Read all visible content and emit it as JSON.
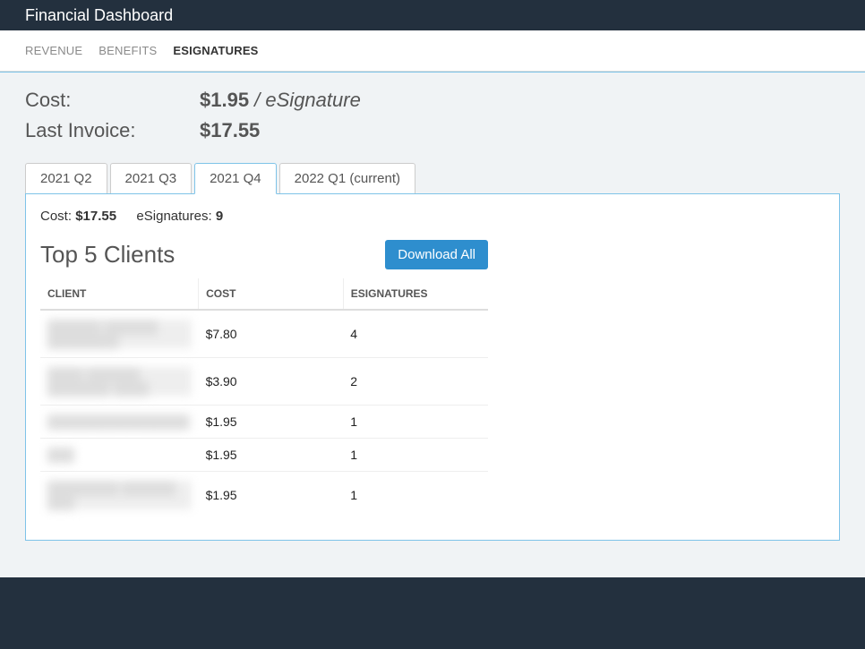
{
  "header": {
    "title": "Financial Dashboard"
  },
  "nav": {
    "items": [
      {
        "label": "Revenue",
        "active": false
      },
      {
        "label": "Benefits",
        "active": false
      },
      {
        "label": "eSignatures",
        "active": true
      }
    ]
  },
  "summary": {
    "cost_label": "Cost:",
    "cost_value": "$1.95",
    "cost_suffix": " / eSignature",
    "invoice_label": "Last Invoice:",
    "invoice_value": "$17.55"
  },
  "quarters": [
    {
      "label": "2021 Q2",
      "active": false
    },
    {
      "label": "2021 Q3",
      "active": false
    },
    {
      "label": "2021 Q4",
      "active": true
    },
    {
      "label": "2022 Q1 (current)",
      "active": false
    }
  ],
  "panel": {
    "cost_label": "Cost: ",
    "cost_value": "$17.55",
    "esig_label": "eSignatures: ",
    "esig_value": "9",
    "title": "Top 5 Clients",
    "download_label": "Download All"
  },
  "table": {
    "headers": {
      "client": "Client",
      "cost": "Cost",
      "esignatures": "eSignatures"
    },
    "rows": [
      {
        "client": "██████ ██████ ████████",
        "cost": "$7.80",
        "esignatures": "4"
      },
      {
        "client": "████ ██████ ███████ ████",
        "cost": "$3.90",
        "esignatures": "2"
      },
      {
        "client": "████████████████",
        "cost": "$1.95",
        "esignatures": "1"
      },
      {
        "client": "███",
        "cost": "$1.95",
        "esignatures": "1"
      },
      {
        "client": "████████ ██████ ███",
        "cost": "$1.95",
        "esignatures": "1"
      }
    ]
  }
}
